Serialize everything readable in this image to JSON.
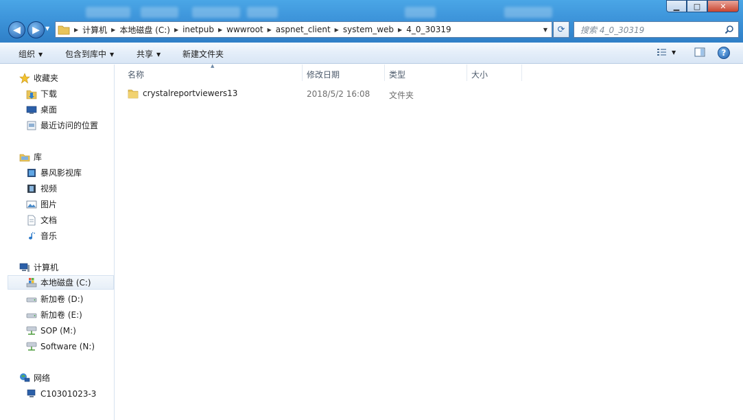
{
  "window": {
    "controls": {
      "minimize": "▁",
      "maximize": "□",
      "close": "✕"
    }
  },
  "address": {
    "crumbs": [
      "计算机",
      "本地磁盘 (C:)",
      "inetpub",
      "wwwroot",
      "aspnet_client",
      "system_web",
      "4_0_30319"
    ]
  },
  "search": {
    "placeholder": "搜索 4_0_30319"
  },
  "toolbar": {
    "organize": "组织",
    "include_in_library": "包含到库中",
    "share": "共享",
    "new_folder": "新建文件夹"
  },
  "navpane": {
    "favorites": {
      "label": "收藏夹",
      "items": [
        "下载",
        "桌面",
        "最近访问的位置"
      ]
    },
    "libraries": {
      "label": "库",
      "items": [
        "暴风影视库",
        "视频",
        "图片",
        "文档",
        "音乐"
      ]
    },
    "computer": {
      "label": "计算机",
      "items": [
        "本地磁盘 (C:)",
        "新加卷 (D:)",
        "新加卷 (E:)",
        "SOP (M:)",
        "Software (N:)"
      ]
    },
    "network": {
      "label": "网络",
      "items": [
        "C10301023-3"
      ]
    }
  },
  "columns": {
    "name": "名称",
    "modified": "修改日期",
    "type": "类型",
    "size": "大小"
  },
  "files": [
    {
      "name": "crystalreportviewers13",
      "modified": "2018/5/2 16:08",
      "type": "文件夹",
      "size": ""
    }
  ],
  "colors": {
    "titlebar": "#3d94da",
    "selection": "#e7eff8",
    "folder": "#e8c45a"
  }
}
